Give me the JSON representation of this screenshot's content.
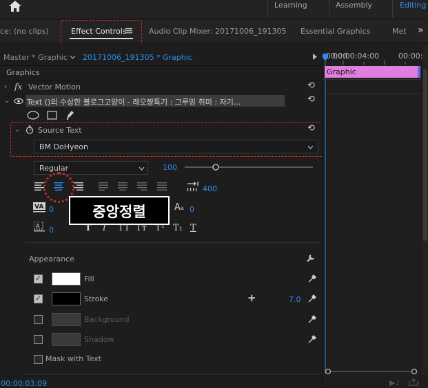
{
  "workspaces": [
    {
      "label": "Learning"
    },
    {
      "label": "Assembly"
    },
    {
      "label": "Editing",
      "active": true
    }
  ],
  "tabs": {
    "source": "ce: (no clips)",
    "effect_controls": "Effect Controls",
    "audio_mixer": "Audio Clip Mixer: 20171006_191305",
    "essential_graphics": "Essential Graphics",
    "overflow": "Met",
    "more": "»"
  },
  "breadcrumb": {
    "master": "Master * Graphic",
    "sequence": "20171006_191305 * Graphic"
  },
  "section_graphics": "Graphics",
  "vector_motion": "Vector Motion",
  "text_layer": {
    "label": "Text (",
    "name": "Text ()의 수상한 블로그고양이 - 레오쨩특기 : 그루밍 취미 : 자기..."
  },
  "source_text": {
    "label": "Source Text",
    "font": "BM DoHyeon",
    "style": "Regular",
    "size": "100",
    "tracking_icon_value": "400",
    "kerning_value": "0",
    "leading_value": "0",
    "baseline_value": "0"
  },
  "callout": "중앙정렬",
  "faux_styles": [
    "T",
    "T",
    "TT",
    "Tт",
    "T¹",
    "T₁",
    "T"
  ],
  "appearance": {
    "label": "Appearance",
    "fill": {
      "label": "Fill",
      "checked": true,
      "color": "#ffffff"
    },
    "stroke": {
      "label": "Stroke",
      "checked": true,
      "color": "#000000",
      "width": "7.0"
    },
    "background": {
      "label": "Background",
      "checked": false
    },
    "shadow": {
      "label": "Shadow",
      "checked": false
    },
    "mask": {
      "label": "Mask with Text",
      "checked": false
    }
  },
  "timeline": {
    "timecode_start": ":00:00",
    "timecode_mid": "00:00:04:00",
    "timecode_end": "00:00:",
    "clip_label": "Graphic",
    "clip_color": "#e07fe0",
    "current_time": "00:00:03:09"
  },
  "colors": {
    "accent": "#2d8ceb",
    "highlight": "#d42d2d",
    "clip": "#e07fe0"
  }
}
